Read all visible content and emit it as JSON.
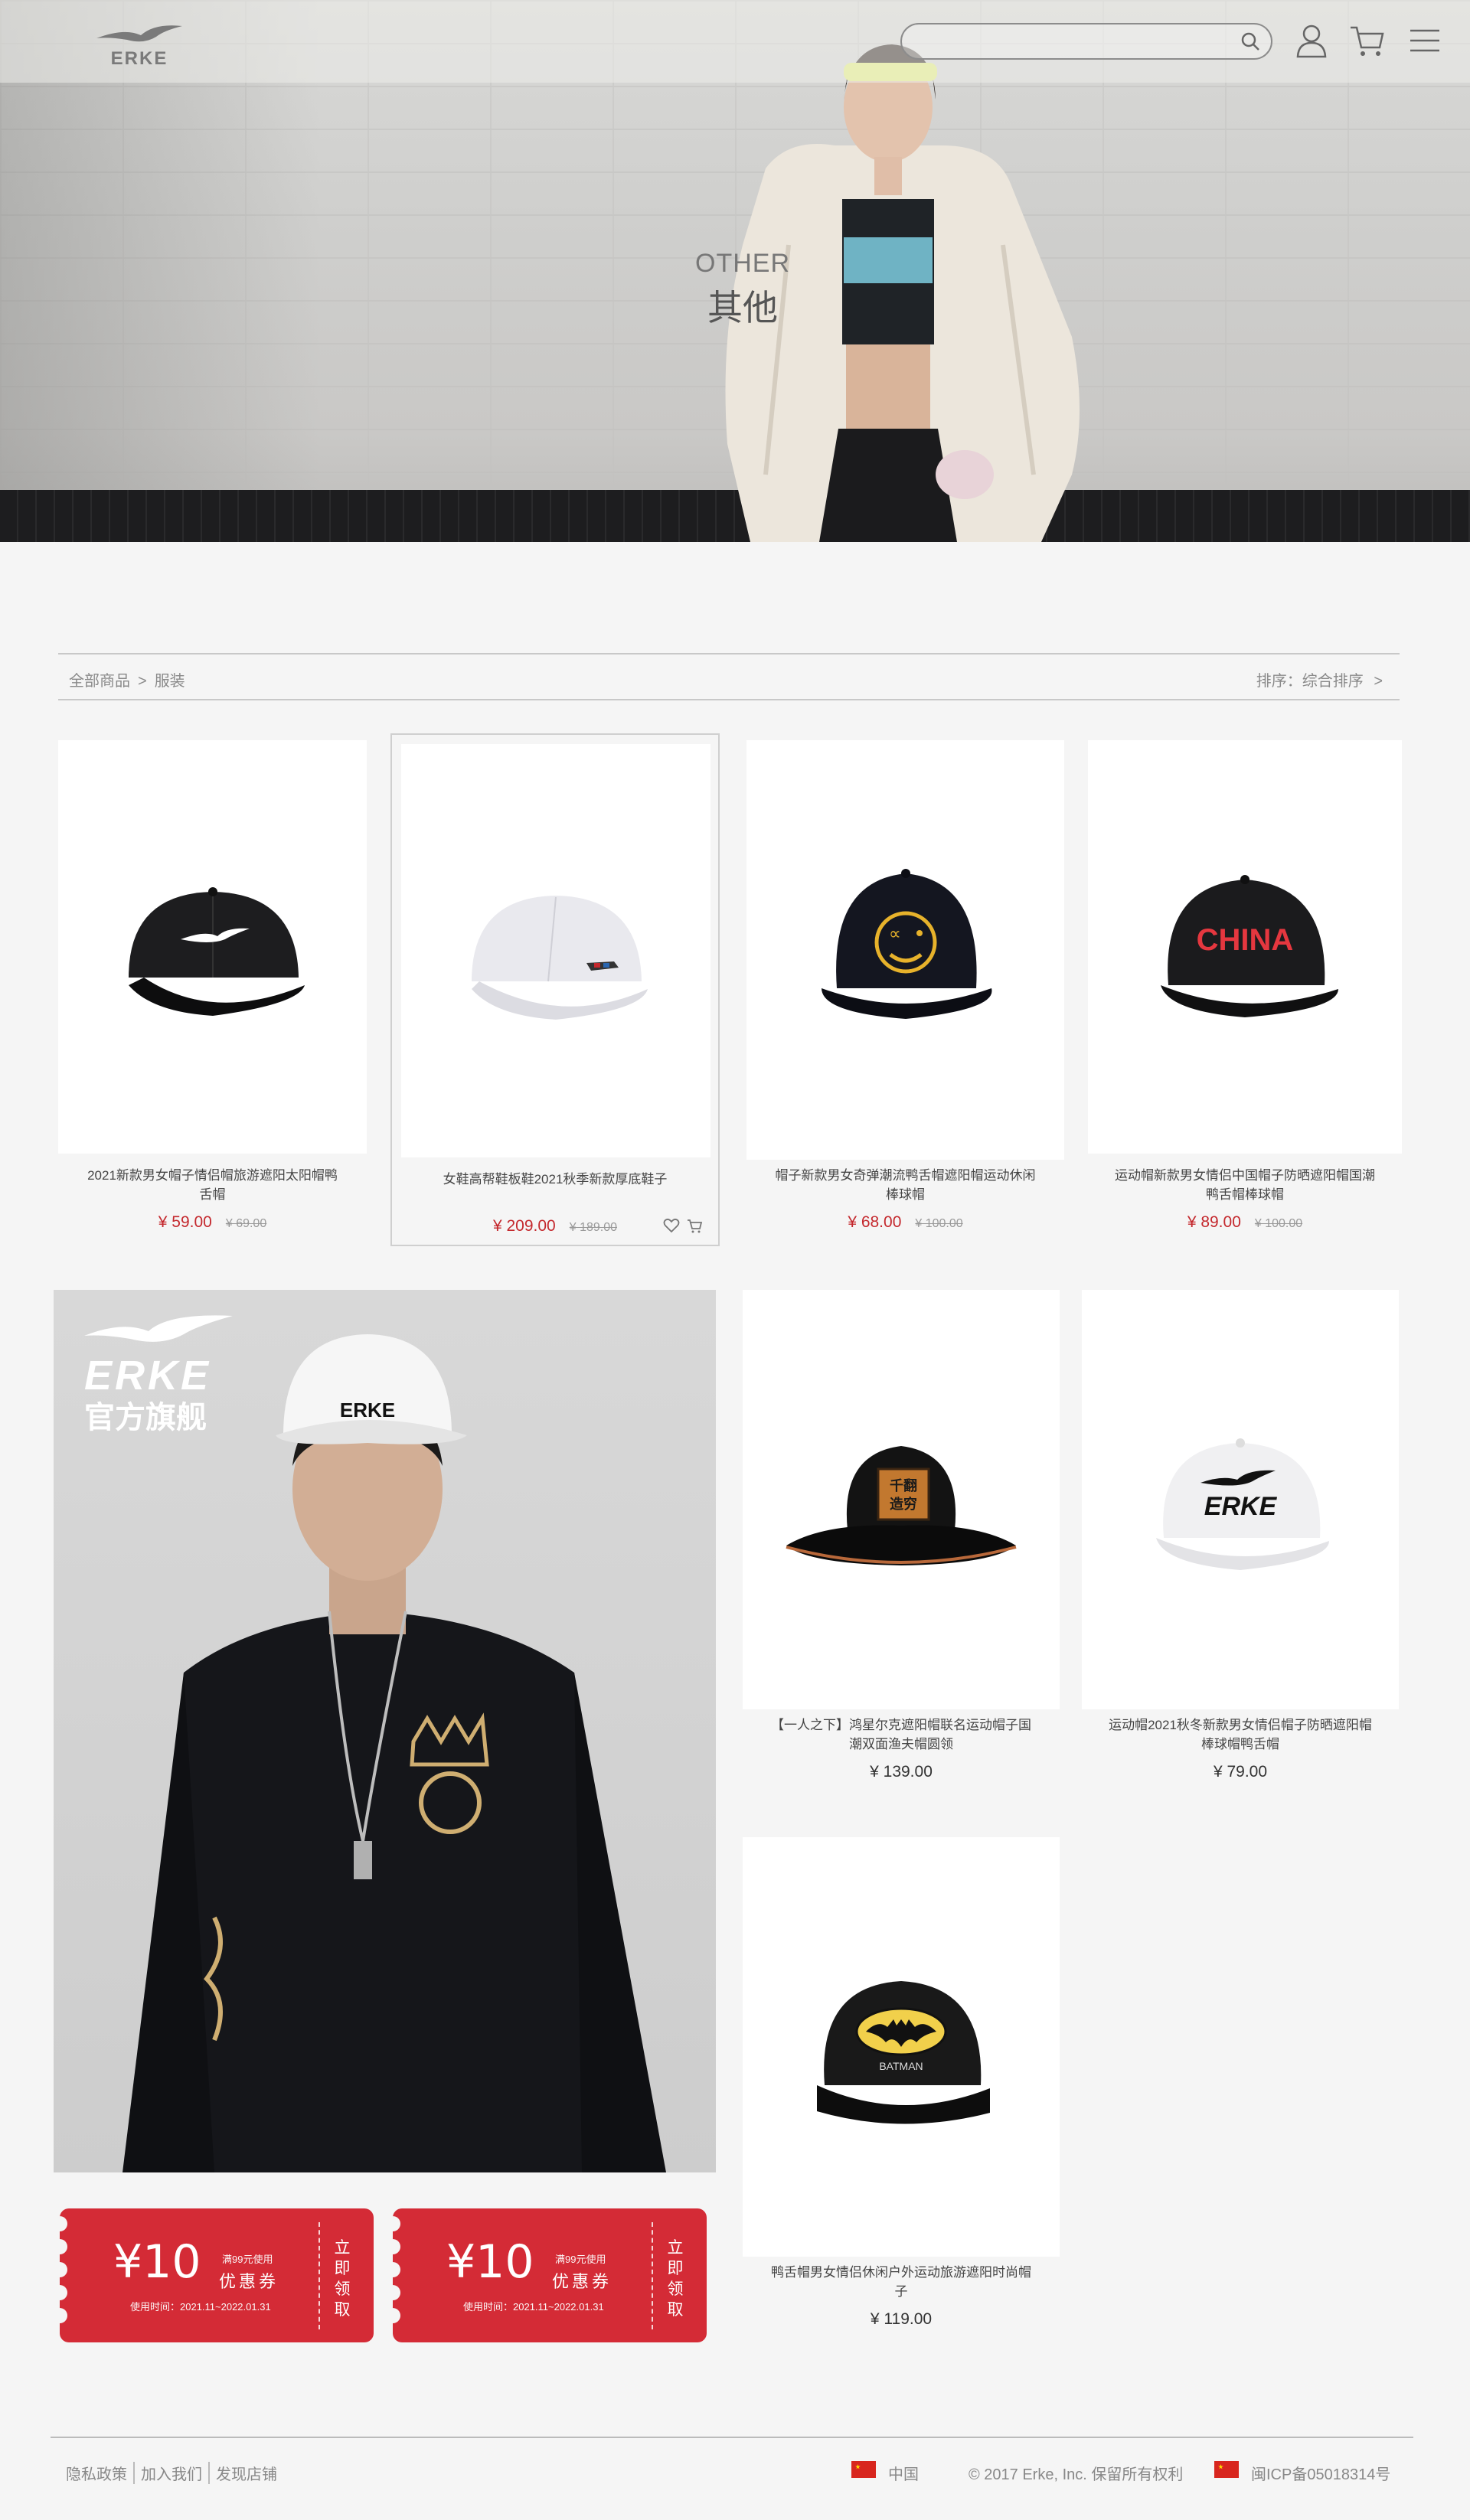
{
  "brand": {
    "logo_text": "ERKE"
  },
  "header": {
    "search_placeholder": "",
    "icons": [
      "search-icon",
      "user-icon",
      "cart-icon",
      "menu-icon"
    ]
  },
  "hero": {
    "title_en": "OTHER",
    "title_cn": "其他"
  },
  "breadcrumb": {
    "items": [
      "全部商品",
      "服装"
    ],
    "separator": ">"
  },
  "sort": {
    "label": "排序：综合排序",
    "chevron": ">"
  },
  "products": [
    {
      "name": "2021新款男女帽子情侣帽旅游遮阳太阳帽鸭舌帽",
      "price": "¥ 59.00",
      "old_price": "¥ 69.00"
    },
    {
      "name": "女鞋高帮鞋板鞋2021秋季新款厚底鞋子",
      "price": "¥ 209.00",
      "old_price": "¥ 189.00"
    },
    {
      "name": "帽子新款男女奇弹潮流鸭舌帽遮阳帽运动休闲棒球帽",
      "price": "¥ 68.00",
      "old_price": "¥ 100.00"
    },
    {
      "name": "运动帽新款男女情侣中国帽子防晒遮阳帽国潮鸭舌帽棒球帽",
      "price": "¥ 89.00",
      "old_price": "¥ 100.00"
    },
    {
      "name": "【一人之下】鸿星尔克遮阳帽联名运动帽子国潮双面渔夫帽圆领",
      "price": "¥ 139.00"
    },
    {
      "name": "运动帽2021秋冬新款男女情侣帽子防晒遮阳帽棒球帽鸭舌帽",
      "price": "¥ 79.00"
    },
    {
      "name": "鸭舌帽男女情侣休闲户外运动旅游遮阳时尚帽子",
      "price": "¥ 119.00"
    }
  ],
  "product_graphics": {
    "cap2_logo": "ERKE",
    "cap3_text": "CHINA",
    "cap4_text": "BATMAN",
    "hat_badge": "千翻 造穷"
  },
  "promo": {
    "brand": "ERKE",
    "subtitle": "官方旗舰",
    "cap_text": "ERKE"
  },
  "coupons": [
    {
      "amount": "¥10",
      "condition": "满99元使用",
      "label": "优惠券",
      "validity": "使用时间：2021.11~2022.01.31",
      "action": "立即领取"
    },
    {
      "amount": "¥10",
      "condition": "满99元使用",
      "label": "优惠券",
      "validity": "使用时间：2021.11~2022.01.31",
      "action": "立即领取"
    }
  ],
  "footer": {
    "links": [
      "隐私政策",
      "加入我们",
      "发现店铺"
    ],
    "region": "中国",
    "copyright": "© 2017 Erke, Inc. 保留所有权利",
    "icp": "闽ICP备05018314号"
  },
  "colors": {
    "accent_red": "#c4282d",
    "coupon_red": "#d42b36",
    "page_bg": "#f5f5f5"
  }
}
